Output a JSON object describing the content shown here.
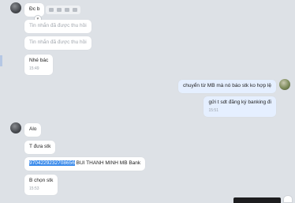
{
  "messages": {
    "m1": {
      "text": "Đc b"
    },
    "m2": {
      "text": "Tin nhắn đã được thu hồi"
    },
    "m3": {
      "text": "Tin nhắn đã được thu hồi"
    },
    "m4": {
      "text": "Nhé bác",
      "time": "15:49"
    },
    "m5": {
      "text": "chuyển từ MB mà nó báo stk ko hợp lệ"
    },
    "m6": {
      "text": "gửi t sdt đăng ký banking đi",
      "time": "15:51"
    },
    "m7": {
      "text": "Alo"
    },
    "m8": {
      "text": "T đưa stk"
    },
    "m9": {
      "highlighted": "9704229232708656",
      "rest": " BUI THANH MINH MB Bank"
    },
    "m10": {
      "text": "B chọn stk",
      "time": "15:53"
    }
  },
  "icons": {
    "hover_tools": [
      "quote-icon",
      "forward-icon",
      "more-icon",
      "ellipsis-icon"
    ],
    "reaction": "like-icon"
  }
}
